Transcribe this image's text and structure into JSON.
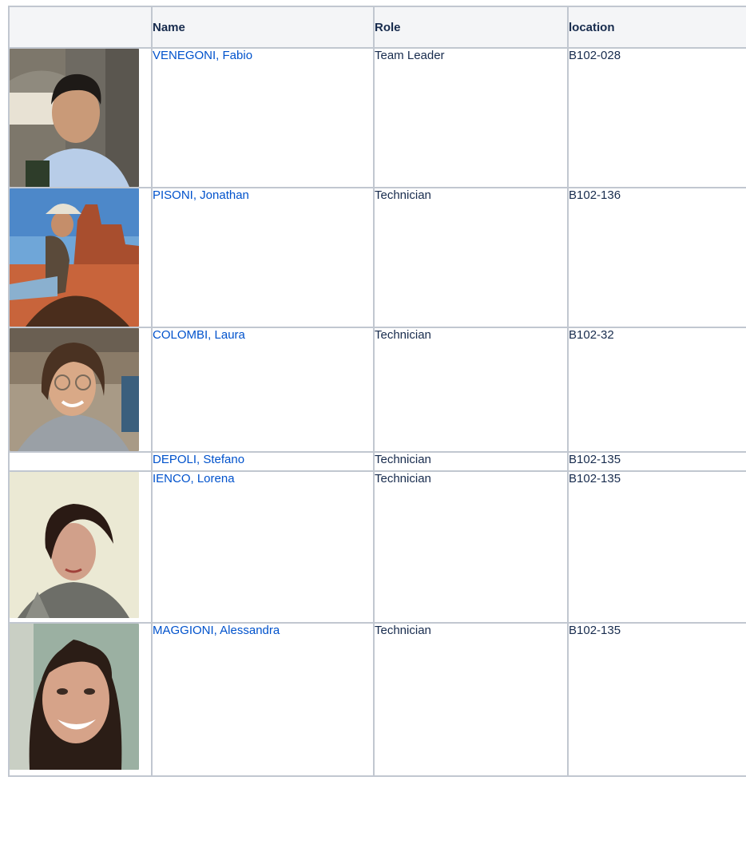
{
  "table": {
    "headers": {
      "photo": "",
      "name": "Name",
      "role": "Role",
      "location": "location"
    },
    "rows": [
      {
        "name": "VENEGONI, Fabio",
        "role": "Team Leader",
        "location": "B102-028",
        "has_photo": true
      },
      {
        "name": "PISONI, Jonathan",
        "role": "Technician",
        "location": "B102-136",
        "has_photo": true
      },
      {
        "name": "COLOMBI, Laura",
        "role": "Technician",
        "location": "B102-32",
        "has_photo": true
      },
      {
        "name": "DEPOLI, Stefano",
        "role": "Technician",
        "location": "B102-135",
        "has_photo": false
      },
      {
        "name": "IENCO, Lorena",
        "role": "Technician",
        "location": "B102-135",
        "has_photo": true
      },
      {
        "name": "MAGGIONI, Alessandra",
        "role": "Technician",
        "location": "B102-135",
        "has_photo": true
      }
    ]
  },
  "colors": {
    "link": "#0052cc",
    "border": "#c1c7d0",
    "header_bg": "#f4f5f7",
    "text": "#172b4d"
  }
}
